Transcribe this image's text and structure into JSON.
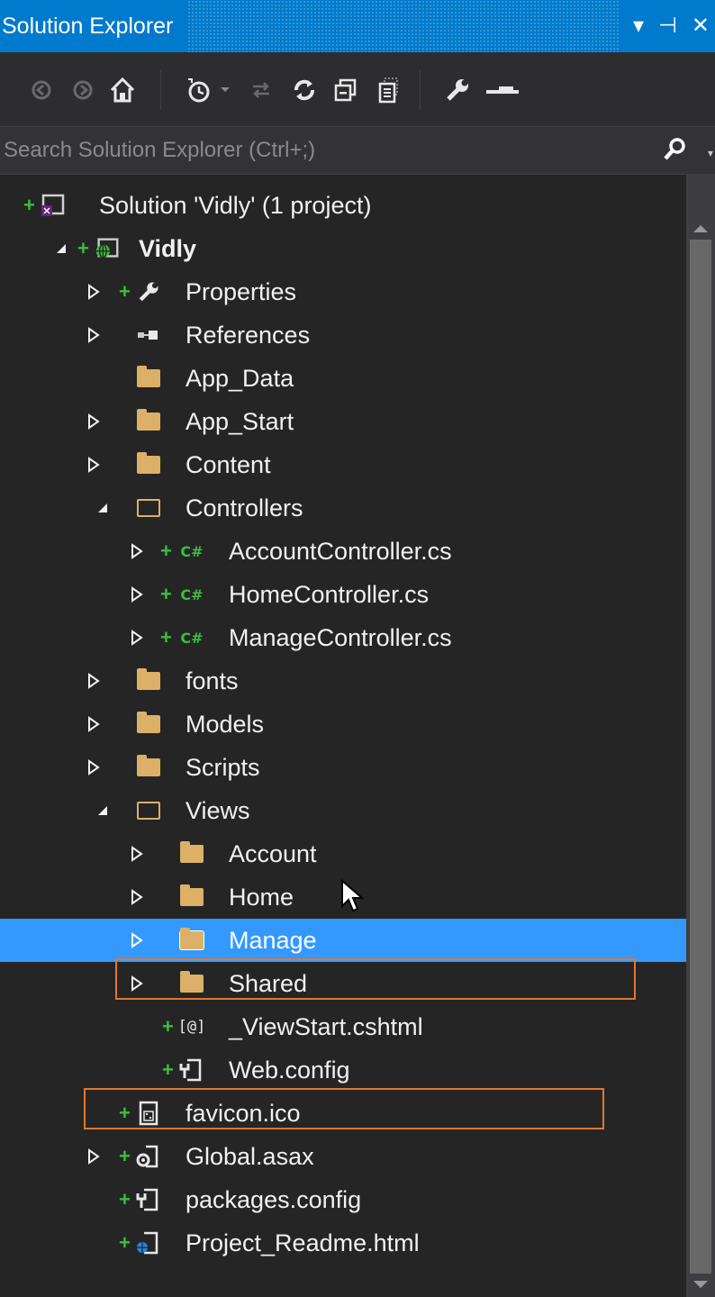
{
  "window": {
    "title": "Solution Explorer",
    "controls": {
      "dropdown": "▾",
      "pin": "⊣",
      "close": "✕"
    }
  },
  "toolbar": {
    "icons": [
      "back-icon",
      "forward-icon",
      "home-icon",
      "history-icon",
      "sync-icon",
      "refresh-icon",
      "collapse-all-icon",
      "show-all-files-icon",
      "properties-icon",
      "preview-icon"
    ]
  },
  "search": {
    "placeholder": "Search Solution Explorer (Ctrl+;)",
    "value": ""
  },
  "tree": {
    "solution": "Solution 'Vidly' (1 project)",
    "project": "Vidly",
    "properties": "Properties",
    "references": "References",
    "app_data": "App_Data",
    "app_start": "App_Start",
    "content": "Content",
    "controllers": "Controllers",
    "account_controller": "AccountController.cs",
    "home_controller": "HomeController.cs",
    "manage_controller": "ManageController.cs",
    "fonts": "fonts",
    "models": "Models",
    "scripts": "Scripts",
    "views": "Views",
    "views_account": "Account",
    "views_home": "Home",
    "views_manage": "Manage",
    "views_shared": "Shared",
    "viewstart": "_ViewStart.cshtml",
    "views_webconfig": "Web.config",
    "favicon": "favicon.ico",
    "global": "Global.asax",
    "packages": "packages.config",
    "readme": "Project_Readme.html"
  },
  "colors": {
    "accent": "#007acc",
    "selection": "#3399ff",
    "highlight": "#e0782d",
    "folder": "#dcb067",
    "added": "#3bbf3b"
  }
}
